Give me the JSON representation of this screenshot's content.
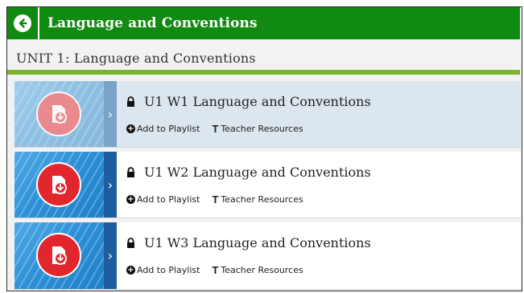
{
  "topbar": {
    "title": "Language and Conventions",
    "back_icon": "arrow-left-circle-icon",
    "color": "#118a11"
  },
  "unit": {
    "title": "UNIT 1: Language and Conventions",
    "rule_color": "#7ab32e"
  },
  "rows": [
    {
      "title": "U1 W1 Language and Conventions",
      "locked": true,
      "add_label": "Add to Playlist",
      "resources_label": "Teacher Resources",
      "selected": true
    },
    {
      "title": "U1 W2 Language and Conventions",
      "locked": true,
      "add_label": "Add to Playlist",
      "resources_label": "Teacher Resources",
      "selected": false
    },
    {
      "title": "U1 W3 Language and Conventions",
      "locked": true,
      "add_label": "Add to Playlist",
      "resources_label": "Teacher Resources",
      "selected": false
    }
  ],
  "icons": {
    "thumbnail": "document-download-icon",
    "lock": "lock-icon",
    "add": "plus-circle-icon",
    "resources": "t-letter-icon",
    "expand": "chevron-right-icon"
  }
}
